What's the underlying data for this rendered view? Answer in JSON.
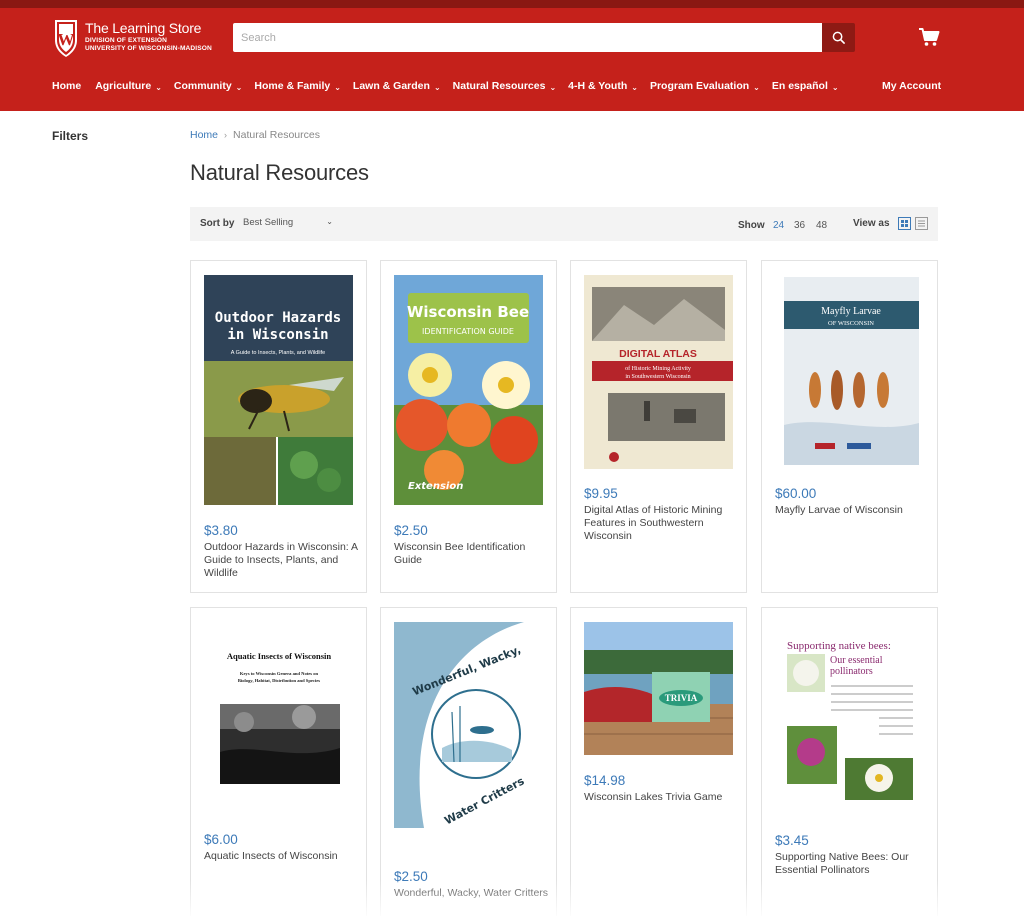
{
  "brand": {
    "title": "The Learning Store",
    "line1": "DIVISION OF EXTENSION",
    "line2": "UNIVERSITY OF WISCONSIN-MADISON",
    "color": "#c5211b"
  },
  "search": {
    "placeholder": "Search",
    "icon": "search-icon"
  },
  "cart_icon": "cart-icon",
  "nav": {
    "items": [
      {
        "label": "Home",
        "dropdown": false
      },
      {
        "label": "Agriculture",
        "dropdown": true
      },
      {
        "label": "Community",
        "dropdown": true
      },
      {
        "label": "Home & Family",
        "dropdown": true
      },
      {
        "label": "Lawn & Garden",
        "dropdown": true
      },
      {
        "label": "Natural Resources",
        "dropdown": true
      },
      {
        "label": "4-H & Youth",
        "dropdown": true
      },
      {
        "label": "Program Evaluation",
        "dropdown": true
      },
      {
        "label": "En español",
        "dropdown": true
      }
    ],
    "account": "My Account"
  },
  "sidebar": {
    "filters_label": "Filters"
  },
  "breadcrumb": {
    "home": "Home",
    "current": "Natural Resources"
  },
  "page_title": "Natural Resources",
  "toolbar": {
    "sort_label": "Sort by",
    "sort_value": "Best Selling",
    "show_label": "Show",
    "show_options": [
      "24",
      "36",
      "48"
    ],
    "show_selected": "24",
    "view_label": "View as",
    "view_modes": [
      "grid",
      "list"
    ],
    "view_selected": "grid"
  },
  "products": [
    {
      "price": "$3.80",
      "name": "Outdoor Hazards in Wisconsin: A Guide to Insects, Plants, and Wildlife",
      "cover": {
        "title1": "Outdoor Hazards",
        "title2": "in Wisconsin",
        "subtitle": "A Guide to Insects, Plants, and Wildlife"
      }
    },
    {
      "price": "$2.50",
      "name": "Wisconsin Bee Identification Guide",
      "cover": {
        "title1": "Wisconsin Bee",
        "title2": "IDENTIFICATION GUIDE",
        "brand": "Extension"
      }
    },
    {
      "price": "$9.95",
      "name": "Digital Atlas of Historic Mining Features in Southwestern Wisconsin",
      "cover": {
        "title1": "DIGITAL ATLAS",
        "title2": "of Historic Mining Activity",
        "title3": "in Southwestern Wisconsin"
      }
    },
    {
      "price": "$60.00",
      "name": "Mayfly Larvae of Wisconsin",
      "cover": {
        "title1": "Mayfly Larvae",
        "title2": "OF WISCONSIN"
      }
    },
    {
      "price": "$6.00",
      "name": "Aquatic Insects of Wisconsin",
      "cover": {
        "title1": "Aquatic Insects of Wisconsin",
        "title2": "Keys to Wisconsin Genera and Notes on",
        "title3": "Biology, Habitat, Distribution and Species"
      }
    },
    {
      "price": "$2.50",
      "name": "Wonderful, Wacky, Water Critters",
      "cover": {
        "title1": "Wonderful, Wacky,",
        "title2": "Water Critters"
      }
    },
    {
      "price": "$14.98",
      "name": "Wisconsin Lakes Trivia Game",
      "cover": {
        "title1": "TRIVIA"
      }
    },
    {
      "price": "$3.45",
      "name": "Supporting Native Bees: Our Essential Pollinators",
      "cover": {
        "title1": "Supporting native bees:",
        "title2": "Our essential",
        "title3": "pollinators"
      }
    }
  ]
}
